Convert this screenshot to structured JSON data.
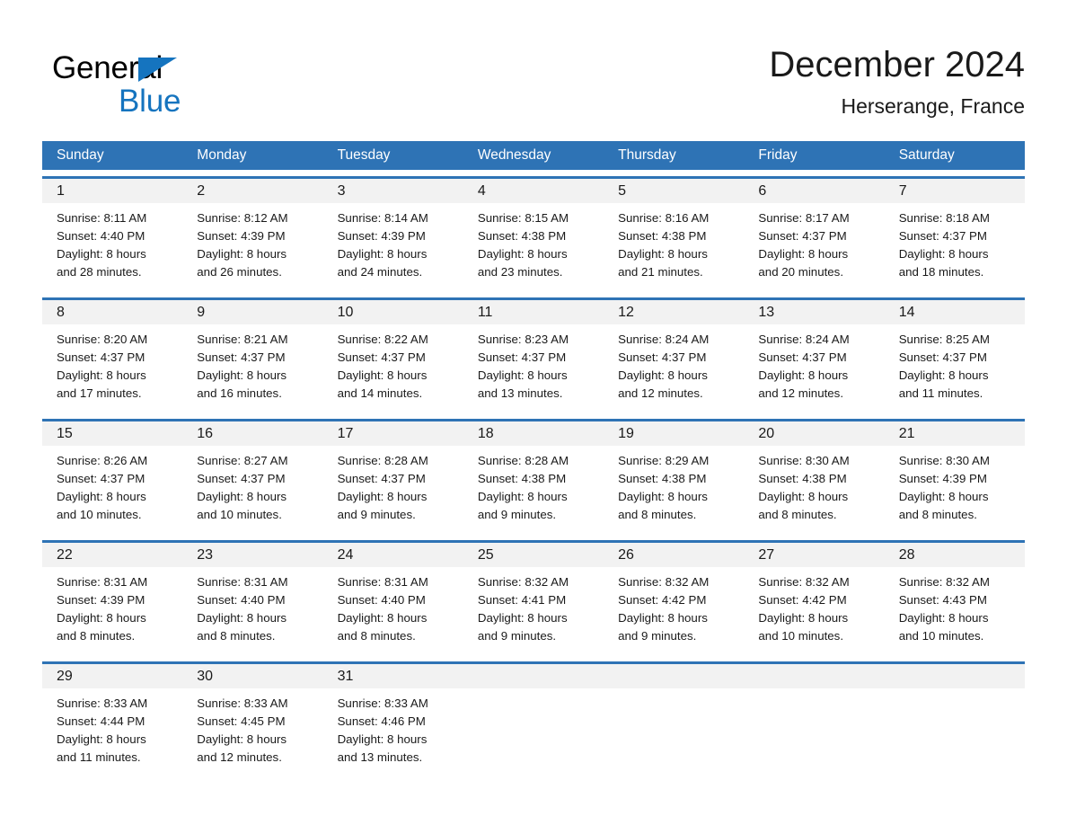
{
  "brand": {
    "name_part1": "General",
    "name_part2": "Blue",
    "triangle_icon": "triangle-icon",
    "accent_color": "#1574bf"
  },
  "header": {
    "title": "December 2024",
    "location": "Herserange, France"
  },
  "theme": {
    "header_blue": "#2e73b5",
    "row_divider_blue": "#2e73b5",
    "daynum_strip": "#f2f2f2",
    "text": "#1a1a1a"
  },
  "weekdays": [
    "Sunday",
    "Monday",
    "Tuesday",
    "Wednesday",
    "Thursday",
    "Friday",
    "Saturday"
  ],
  "weeks": [
    [
      {
        "day": "1",
        "sunrise": "Sunrise: 8:11 AM",
        "sunset": "Sunset: 4:40 PM",
        "daylight_line1": "Daylight: 8 hours",
        "daylight_line2": "and 28 minutes."
      },
      {
        "day": "2",
        "sunrise": "Sunrise: 8:12 AM",
        "sunset": "Sunset: 4:39 PM",
        "daylight_line1": "Daylight: 8 hours",
        "daylight_line2": "and 26 minutes."
      },
      {
        "day": "3",
        "sunrise": "Sunrise: 8:14 AM",
        "sunset": "Sunset: 4:39 PM",
        "daylight_line1": "Daylight: 8 hours",
        "daylight_line2": "and 24 minutes."
      },
      {
        "day": "4",
        "sunrise": "Sunrise: 8:15 AM",
        "sunset": "Sunset: 4:38 PM",
        "daylight_line1": "Daylight: 8 hours",
        "daylight_line2": "and 23 minutes."
      },
      {
        "day": "5",
        "sunrise": "Sunrise: 8:16 AM",
        "sunset": "Sunset: 4:38 PM",
        "daylight_line1": "Daylight: 8 hours",
        "daylight_line2": "and 21 minutes."
      },
      {
        "day": "6",
        "sunrise": "Sunrise: 8:17 AM",
        "sunset": "Sunset: 4:37 PM",
        "daylight_line1": "Daylight: 8 hours",
        "daylight_line2": "and 20 minutes."
      },
      {
        "day": "7",
        "sunrise": "Sunrise: 8:18 AM",
        "sunset": "Sunset: 4:37 PM",
        "daylight_line1": "Daylight: 8 hours",
        "daylight_line2": "and 18 minutes."
      }
    ],
    [
      {
        "day": "8",
        "sunrise": "Sunrise: 8:20 AM",
        "sunset": "Sunset: 4:37 PM",
        "daylight_line1": "Daylight: 8 hours",
        "daylight_line2": "and 17 minutes."
      },
      {
        "day": "9",
        "sunrise": "Sunrise: 8:21 AM",
        "sunset": "Sunset: 4:37 PM",
        "daylight_line1": "Daylight: 8 hours",
        "daylight_line2": "and 16 minutes."
      },
      {
        "day": "10",
        "sunrise": "Sunrise: 8:22 AM",
        "sunset": "Sunset: 4:37 PM",
        "daylight_line1": "Daylight: 8 hours",
        "daylight_line2": "and 14 minutes."
      },
      {
        "day": "11",
        "sunrise": "Sunrise: 8:23 AM",
        "sunset": "Sunset: 4:37 PM",
        "daylight_line1": "Daylight: 8 hours",
        "daylight_line2": "and 13 minutes."
      },
      {
        "day": "12",
        "sunrise": "Sunrise: 8:24 AM",
        "sunset": "Sunset: 4:37 PM",
        "daylight_line1": "Daylight: 8 hours",
        "daylight_line2": "and 12 minutes."
      },
      {
        "day": "13",
        "sunrise": "Sunrise: 8:24 AM",
        "sunset": "Sunset: 4:37 PM",
        "daylight_line1": "Daylight: 8 hours",
        "daylight_line2": "and 12 minutes."
      },
      {
        "day": "14",
        "sunrise": "Sunrise: 8:25 AM",
        "sunset": "Sunset: 4:37 PM",
        "daylight_line1": "Daylight: 8 hours",
        "daylight_line2": "and 11 minutes."
      }
    ],
    [
      {
        "day": "15",
        "sunrise": "Sunrise: 8:26 AM",
        "sunset": "Sunset: 4:37 PM",
        "daylight_line1": "Daylight: 8 hours",
        "daylight_line2": "and 10 minutes."
      },
      {
        "day": "16",
        "sunrise": "Sunrise: 8:27 AM",
        "sunset": "Sunset: 4:37 PM",
        "daylight_line1": "Daylight: 8 hours",
        "daylight_line2": "and 10 minutes."
      },
      {
        "day": "17",
        "sunrise": "Sunrise: 8:28 AM",
        "sunset": "Sunset: 4:37 PM",
        "daylight_line1": "Daylight: 8 hours",
        "daylight_line2": "and 9 minutes."
      },
      {
        "day": "18",
        "sunrise": "Sunrise: 8:28 AM",
        "sunset": "Sunset: 4:38 PM",
        "daylight_line1": "Daylight: 8 hours",
        "daylight_line2": "and 9 minutes."
      },
      {
        "day": "19",
        "sunrise": "Sunrise: 8:29 AM",
        "sunset": "Sunset: 4:38 PM",
        "daylight_line1": "Daylight: 8 hours",
        "daylight_line2": "and 8 minutes."
      },
      {
        "day": "20",
        "sunrise": "Sunrise: 8:30 AM",
        "sunset": "Sunset: 4:38 PM",
        "daylight_line1": "Daylight: 8 hours",
        "daylight_line2": "and 8 minutes."
      },
      {
        "day": "21",
        "sunrise": "Sunrise: 8:30 AM",
        "sunset": "Sunset: 4:39 PM",
        "daylight_line1": "Daylight: 8 hours",
        "daylight_line2": "and 8 minutes."
      }
    ],
    [
      {
        "day": "22",
        "sunrise": "Sunrise: 8:31 AM",
        "sunset": "Sunset: 4:39 PM",
        "daylight_line1": "Daylight: 8 hours",
        "daylight_line2": "and 8 minutes."
      },
      {
        "day": "23",
        "sunrise": "Sunrise: 8:31 AM",
        "sunset": "Sunset: 4:40 PM",
        "daylight_line1": "Daylight: 8 hours",
        "daylight_line2": "and 8 minutes."
      },
      {
        "day": "24",
        "sunrise": "Sunrise: 8:31 AM",
        "sunset": "Sunset: 4:40 PM",
        "daylight_line1": "Daylight: 8 hours",
        "daylight_line2": "and 8 minutes."
      },
      {
        "day": "25",
        "sunrise": "Sunrise: 8:32 AM",
        "sunset": "Sunset: 4:41 PM",
        "daylight_line1": "Daylight: 8 hours",
        "daylight_line2": "and 9 minutes."
      },
      {
        "day": "26",
        "sunrise": "Sunrise: 8:32 AM",
        "sunset": "Sunset: 4:42 PM",
        "daylight_line1": "Daylight: 8 hours",
        "daylight_line2": "and 9 minutes."
      },
      {
        "day": "27",
        "sunrise": "Sunrise: 8:32 AM",
        "sunset": "Sunset: 4:42 PM",
        "daylight_line1": "Daylight: 8 hours",
        "daylight_line2": "and 10 minutes."
      },
      {
        "day": "28",
        "sunrise": "Sunrise: 8:32 AM",
        "sunset": "Sunset: 4:43 PM",
        "daylight_line1": "Daylight: 8 hours",
        "daylight_line2": "and 10 minutes."
      }
    ],
    [
      {
        "day": "29",
        "sunrise": "Sunrise: 8:33 AM",
        "sunset": "Sunset: 4:44 PM",
        "daylight_line1": "Daylight: 8 hours",
        "daylight_line2": "and 11 minutes."
      },
      {
        "day": "30",
        "sunrise": "Sunrise: 8:33 AM",
        "sunset": "Sunset: 4:45 PM",
        "daylight_line1": "Daylight: 8 hours",
        "daylight_line2": "and 12 minutes."
      },
      {
        "day": "31",
        "sunrise": "Sunrise: 8:33 AM",
        "sunset": "Sunset: 4:46 PM",
        "daylight_line1": "Daylight: 8 hours",
        "daylight_line2": "and 13 minutes."
      },
      {
        "day": "",
        "sunrise": "",
        "sunset": "",
        "daylight_line1": "",
        "daylight_line2": ""
      },
      {
        "day": "",
        "sunrise": "",
        "sunset": "",
        "daylight_line1": "",
        "daylight_line2": ""
      },
      {
        "day": "",
        "sunrise": "",
        "sunset": "",
        "daylight_line1": "",
        "daylight_line2": ""
      },
      {
        "day": "",
        "sunrise": "",
        "sunset": "",
        "daylight_line1": "",
        "daylight_line2": ""
      }
    ]
  ]
}
